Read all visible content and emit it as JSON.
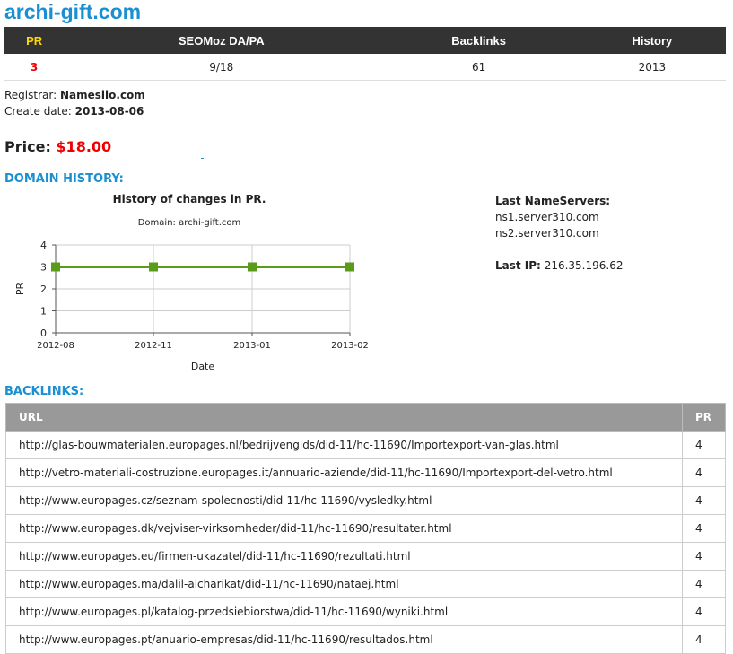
{
  "header": {
    "title": "archi-gift.com"
  },
  "stats": {
    "headers": [
      "PR",
      "SEOMoz DA/PA",
      "Backlinks",
      "History"
    ],
    "values": [
      "3",
      "9/18",
      "61",
      "2013"
    ]
  },
  "registration": {
    "registrar_label": "Registrar:",
    "registrar": "Namesilo.com",
    "create_label": "Create date:",
    "create_date": "2013-08-06"
  },
  "price": {
    "label": "Price:",
    "value": "$18.00"
  },
  "domain_history": {
    "heading": "DOMAIN HISTORY:"
  },
  "chart_data": {
    "type": "line",
    "title": "History of changes in PR.",
    "subtitle": "Domain: archi-gift.com",
    "xlabel": "Date",
    "ylabel": "PR",
    "categories": [
      "2012-08",
      "2012-11",
      "2013-01",
      "2013-02"
    ],
    "values": [
      3,
      3,
      3,
      3
    ],
    "ylim": [
      0,
      4
    ],
    "yticks": [
      "0",
      "1",
      "2",
      "3",
      "4"
    ],
    "grid": true,
    "color": "#5a9c1a"
  },
  "nameservers": {
    "label": "Last NameServers:",
    "items": [
      "ns1.server310.com",
      "ns2.server310.com"
    ],
    "ip_label": "Last IP:",
    "ip": "216.35.196.62"
  },
  "backlinks": {
    "heading": "BACKLINKS:",
    "col_url": "URL",
    "col_pr": "PR",
    "rows": [
      {
        "url": "http://glas-bouwmaterialen.europages.nl/bedrijvengids/did-11/hc-11690/Importexport-van-glas.html",
        "pr": "4"
      },
      {
        "url": "http://vetro-materiali-costruzione.europages.it/annuario-aziende/did-11/hc-11690/Importexport-del-vetro.html",
        "pr": "4"
      },
      {
        "url": "http://www.europages.cz/seznam-spolecnosti/did-11/hc-11690/vysledky.html",
        "pr": "4"
      },
      {
        "url": "http://www.europages.dk/vejviser-virksomheder/did-11/hc-11690/resultater.html",
        "pr": "4"
      },
      {
        "url": "http://www.europages.eu/firmen-ukazatel/did-11/hc-11690/rezultati.html",
        "pr": "4"
      },
      {
        "url": "http://www.europages.ma/dalil-alcharikat/did-11/hc-11690/nataej.html",
        "pr": "4"
      },
      {
        "url": "http://www.europages.pl/katalog-przedsiebiorstwa/did-11/hc-11690/wyniki.html",
        "pr": "4"
      },
      {
        "url": "http://www.europages.pt/anuario-empresas/did-11/hc-11690/resultados.html",
        "pr": "4"
      }
    ]
  },
  "colors": {
    "accent": "#1a8fd1",
    "price": "#e00000",
    "pr_header": "#ffd800",
    "chart_line": "#5a9c1a"
  }
}
